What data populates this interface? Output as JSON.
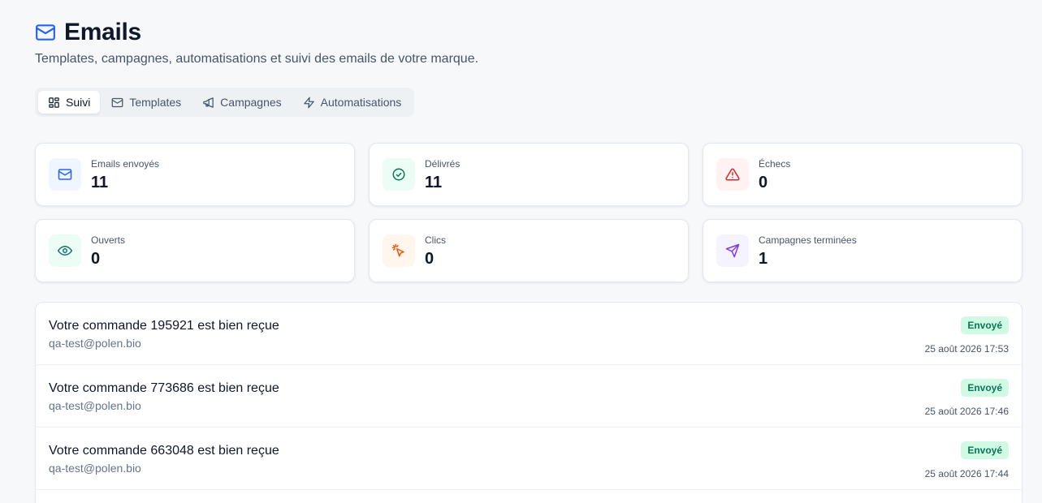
{
  "header": {
    "title": "Emails",
    "subtitle": "Templates, campagnes, automatisations et suivi des emails de votre marque."
  },
  "tabs": [
    {
      "label": "Suivi",
      "icon": "dashboard-icon",
      "active": true
    },
    {
      "label": "Templates",
      "icon": "mail-icon",
      "active": false
    },
    {
      "label": "Campagnes",
      "icon": "megaphone-icon",
      "active": false
    },
    {
      "label": "Automatisations",
      "icon": "zap-icon",
      "active": false
    }
  ],
  "stats": [
    {
      "label": "Emails envoyés",
      "value": "11",
      "icon": "mail-icon",
      "color": "#2563eb",
      "bg": "#eff6ff"
    },
    {
      "label": "Délivrés",
      "value": "11",
      "icon": "check-circle-icon",
      "color": "#047857",
      "bg": "#ecfdf5"
    },
    {
      "label": "Échecs",
      "value": "0",
      "icon": "alert-triangle-icon",
      "color": "#dc2626",
      "bg": "#fef2f2"
    },
    {
      "label": "Ouverts",
      "value": "0",
      "icon": "eye-icon",
      "color": "#0f766e",
      "bg": "#ecfdf5"
    },
    {
      "label": "Clics",
      "value": "0",
      "icon": "cursor-click-icon",
      "color": "#ea580c",
      "bg": "#fff7ed"
    },
    {
      "label": "Campagnes terminées",
      "value": "1",
      "icon": "send-icon",
      "color": "#7c3aed",
      "bg": "#f5f3ff"
    }
  ],
  "emails": [
    {
      "subject": "Votre commande 195921 est bien reçue",
      "to": "qa-test@polen.bio",
      "status": "Envoyé",
      "date": "25 août 2026 17:53"
    },
    {
      "subject": "Votre commande 773686 est bien reçue",
      "to": "qa-test@polen.bio",
      "status": "Envoyé",
      "date": "25 août 2026 17:46"
    },
    {
      "subject": "Votre commande 663048 est bien reçue",
      "to": "qa-test@polen.bio",
      "status": "Envoyé",
      "date": "25 août 2026 17:44"
    }
  ]
}
